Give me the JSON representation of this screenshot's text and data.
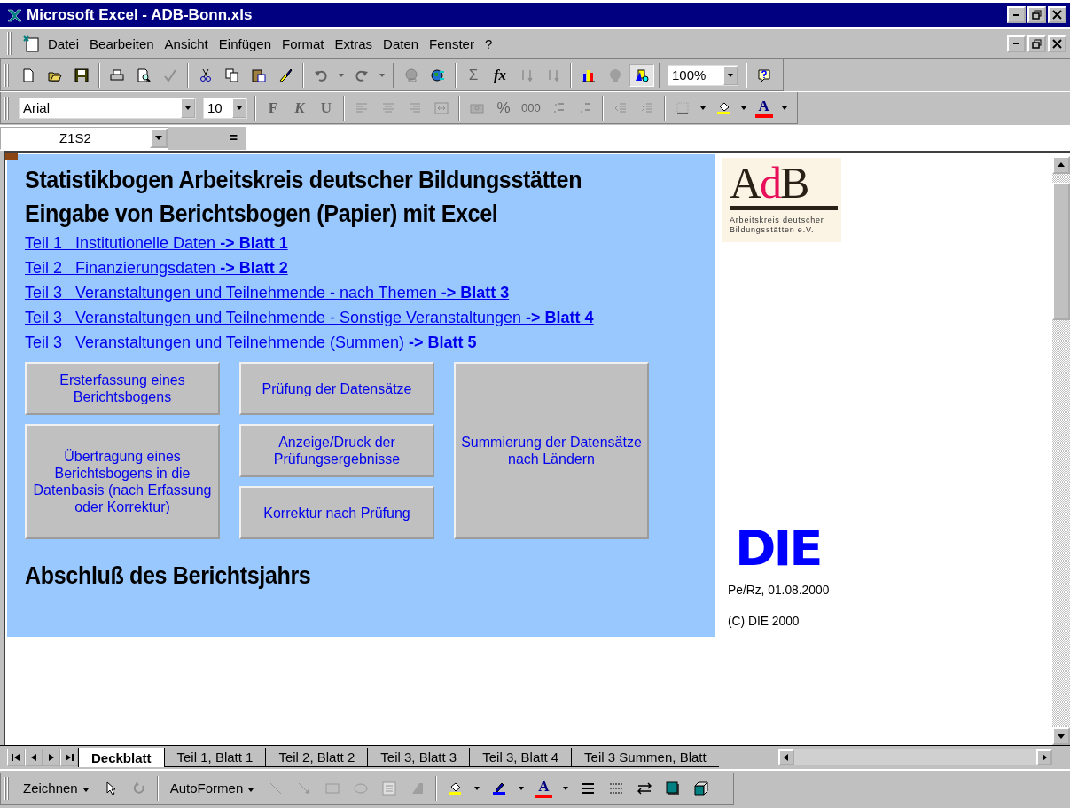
{
  "window": {
    "title": "Microsoft Excel - ADB-Bonn.xls"
  },
  "menu": [
    "Datei",
    "Bearbeiten",
    "Ansicht",
    "Einfügen",
    "Format",
    "Extras",
    "Daten",
    "Fenster",
    "?"
  ],
  "toolbars": [
    {
      "items": [
        {
          "kind": "new",
          "disabled": false,
          "pressed": false
        },
        {
          "kind": "open",
          "disabled": false,
          "pressed": false
        },
        {
          "kind": "save",
          "disabled": false,
          "pressed": false
        },
        {
          "kind": "separator"
        },
        {
          "kind": "print",
          "disabled": false,
          "pressed": false
        },
        {
          "kind": "preview",
          "disabled": false,
          "pressed": false
        },
        {
          "kind": "spell",
          "disabled": true,
          "pressed": false
        },
        {
          "kind": "separator"
        },
        {
          "kind": "cut",
          "disabled": false,
          "pressed": false
        },
        {
          "kind": "copy",
          "disabled": false,
          "pressed": false
        },
        {
          "kind": "paste",
          "disabled": false,
          "pressed": false
        },
        {
          "kind": "painter",
          "disabled": false,
          "pressed": false
        },
        {
          "kind": "separator"
        },
        {
          "kind": "undo",
          "disabled": true,
          "pressed": false
        },
        {
          "kind": "caret",
          "disabled": true,
          "pressed": false
        },
        {
          "kind": "redo",
          "disabled": true,
          "pressed": false
        },
        {
          "kind": "caret",
          "disabled": true,
          "pressed": false
        },
        {
          "kind": "separator"
        },
        {
          "kind": "hyperlink",
          "disabled": true,
          "pressed": false
        },
        {
          "kind": "web",
          "disabled": false,
          "pressed": false
        },
        {
          "kind": "separator"
        },
        {
          "kind": "sum",
          "label": "Σ",
          "disabled": true,
          "pressed": false
        },
        {
          "kind": "function",
          "label": "fx",
          "disabled": false,
          "pressed": false
        },
        {
          "kind": "sort-asc",
          "disabled": true,
          "pressed": false
        },
        {
          "kind": "sort-desc",
          "disabled": true,
          "pressed": false
        },
        {
          "kind": "separator"
        },
        {
          "kind": "chart",
          "disabled": false,
          "pressed": false
        },
        {
          "kind": "map",
          "disabled": true,
          "pressed": false
        },
        {
          "kind": "drawing",
          "disabled": false,
          "pressed": true
        },
        {
          "kind": "separator"
        },
        {
          "kind": "zoom-field",
          "value": "100%"
        },
        {
          "kind": "separator"
        },
        {
          "kind": "help",
          "disabled": false,
          "pressed": false
        }
      ]
    },
    {
      "items": [
        {
          "kind": "font-field",
          "value": "Arial"
        },
        {
          "kind": "size-field",
          "value": "10"
        },
        {
          "kind": "separator"
        },
        {
          "kind": "bold",
          "label": "F",
          "disabled": true,
          "pressed": false
        },
        {
          "kind": "italic",
          "label": "K",
          "disabled": true,
          "pressed": false
        },
        {
          "kind": "underline",
          "label": "U",
          "disabled": true,
          "pressed": false
        },
        {
          "kind": "separator"
        },
        {
          "kind": "align-left",
          "disabled": true,
          "pressed": false
        },
        {
          "kind": "align-center",
          "disabled": true,
          "pressed": false
        },
        {
          "kind": "align-right",
          "disabled": true,
          "pressed": false
        },
        {
          "kind": "merge",
          "disabled": true,
          "pressed": false
        },
        {
          "kind": "separator"
        },
        {
          "kind": "currency",
          "disabled": true,
          "pressed": false
        },
        {
          "kind": "percent",
          "label": "%",
          "disabled": true,
          "pressed": false
        },
        {
          "kind": "thousands",
          "label": "000",
          "disabled": true,
          "pressed": false
        },
        {
          "kind": "inc-decimal",
          "disabled": true,
          "pressed": false
        },
        {
          "kind": "dec-decimal",
          "disabled": true,
          "pressed": false
        },
        {
          "kind": "separator"
        },
        {
          "kind": "outdent",
          "disabled": true,
          "pressed": false
        },
        {
          "kind": "indent",
          "disabled": true,
          "pressed": false
        },
        {
          "kind": "separator"
        },
        {
          "kind": "borders",
          "disabled": true,
          "pressed": false
        },
        {
          "kind": "caret",
          "disabled": false,
          "pressed": false
        },
        {
          "kind": "fill",
          "disabled": false,
          "pressed": false
        },
        {
          "kind": "caret",
          "disabled": false,
          "pressed": false
        },
        {
          "kind": "font-color",
          "label": "A",
          "disabled": false,
          "pressed": false
        },
        {
          "kind": "caret",
          "disabled": false,
          "pressed": false
        }
      ]
    }
  ],
  "formula_bar": {
    "name_box": "Z1S2",
    "equals": "="
  },
  "sheet": {
    "headings": [
      "Statistikbogen Arbeitskreis deutscher Bildungsstätten",
      "Eingabe von Berichtsbogen (Papier) mit Excel"
    ],
    "links": [
      "Teil 1   Institutionelle Daten **-> Blatt 1**",
      "Teil 2   Finanzierungsdaten **-> Blatt 2**",
      "Teil 3   Veranstaltungen und Teilnehmende - nach Themen **-> Blatt 3**",
      "Teil 3   Veranstaltungen und Teilnehmende - Sonstige Veranstaltungen **-> Blatt 4**",
      "Teil 3   Veranstaltungen und Teilnehmende (Summen) **-> Blatt 5**"
    ],
    "buttons": [
      "Ersterfassung eines Berichtsbogens",
      "Prüfung der Datensätze",
      "Summierung der Datensätze nach Ländern",
      "Übertragung eines Berichtsbogens in die Datenbasis (nach Erfassung oder Korrektur)",
      "Anzeige/Druck der Prüfungsergebnisse",
      "Korrektur nach Prüfung"
    ],
    "footer_heading": "Abschluß des Berichtsjahrs",
    "adb_logo": {
      "letters": [
        {
          "text": "A",
          "color": "#2a2016"
        },
        {
          "text": "d",
          "color": "#e8105a"
        },
        {
          "text": "B",
          "color": "#2a2016"
        }
      ],
      "caption": [
        "Arbeitskreis deutscher",
        "Bildungsstätten e.V."
      ]
    },
    "die_logo": "DIE",
    "date_note": "Pe/Rz, 01.08.2000",
    "copyright": "(C) DIE 2000"
  },
  "sheet_tabs": [
    {
      "label": "Deckblatt",
      "selected": true
    },
    {
      "label": "Teil 1, Blatt 1",
      "selected": false
    },
    {
      "label": "Teil 2, Blatt 2",
      "selected": false
    },
    {
      "label": "Teil 3, Blatt 3",
      "selected": false
    },
    {
      "label": "Teil 3, Blatt 4",
      "selected": false
    },
    {
      "label": "Teil 3 Summen, Blatt",
      "selected": false
    }
  ],
  "drawing_toolbar": {
    "items": [
      {
        "kind": "menu",
        "label": "Zeichnen",
        "disabled": false
      },
      {
        "kind": "pointer",
        "disabled": false
      },
      {
        "kind": "rotate",
        "disabled": true
      },
      {
        "kind": "separator"
      },
      {
        "kind": "menu",
        "label": "AutoFormen",
        "disabled": false
      },
      {
        "kind": "line",
        "disabled": true
      },
      {
        "kind": "arrow",
        "disabled": true
      },
      {
        "kind": "rectangle",
        "disabled": true
      },
      {
        "kind": "oval",
        "disabled": true
      },
      {
        "kind": "textbox",
        "disabled": true
      },
      {
        "kind": "wordart",
        "disabled": true
      },
      {
        "kind": "separator"
      },
      {
        "kind": "fill",
        "disabled": false
      },
      {
        "kind": "caret",
        "disabled": false
      },
      {
        "kind": "line-color",
        "disabled": false
      },
      {
        "kind": "caret",
        "disabled": false
      },
      {
        "kind": "font-color",
        "label": "A",
        "disabled": false
      },
      {
        "kind": "caret",
        "disabled": false
      },
      {
        "kind": "line-style",
        "disabled": false
      },
      {
        "kind": "dash-style",
        "disabled": false
      },
      {
        "kind": "arrow-style",
        "disabled": false
      },
      {
        "kind": "shadow",
        "disabled": false
      },
      {
        "kind": "extrusion",
        "disabled": false
      }
    ]
  }
}
